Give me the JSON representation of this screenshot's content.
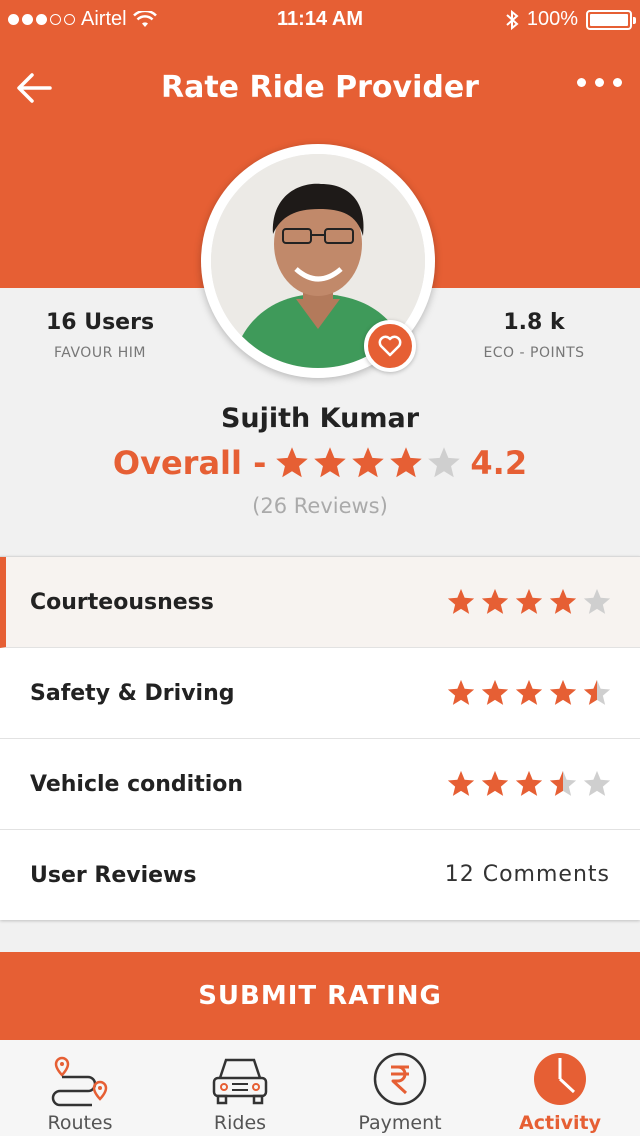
{
  "status_bar": {
    "carrier": "Airtel",
    "time": "11:14 AM",
    "battery": "100%"
  },
  "header": {
    "title": "Rate Ride Provider"
  },
  "profile": {
    "name": "Sujith Kumar",
    "favour_count": "16 Users",
    "favour_label": "FAVOUR HIM",
    "eco_points": "1.8 k",
    "eco_label": "ECO - POINTS",
    "overall_label": "Overall -",
    "overall_rating": 4.2,
    "overall_rating_text": "4.2",
    "reviews_text": "(26 Reviews)"
  },
  "ratings": [
    {
      "label": "Courteousness",
      "stars": 4.0
    },
    {
      "label": "Safety & Driving",
      "stars": 4.5
    },
    {
      "label": "Vehicle condition",
      "stars": 3.5
    }
  ],
  "user_reviews": {
    "label": "User Reviews",
    "value": "12 Comments"
  },
  "submit_label": "SUBMIT RATING",
  "tabs": [
    {
      "label": "Routes",
      "icon": "route-icon"
    },
    {
      "label": "Rides",
      "icon": "car-icon"
    },
    {
      "label": "Payment",
      "icon": "rupee-icon"
    },
    {
      "label": "Activity",
      "icon": "activity-pie-icon",
      "active": true
    }
  ],
  "colors": {
    "accent": "#e65f34",
    "star_empty": "#cfcfcf"
  }
}
